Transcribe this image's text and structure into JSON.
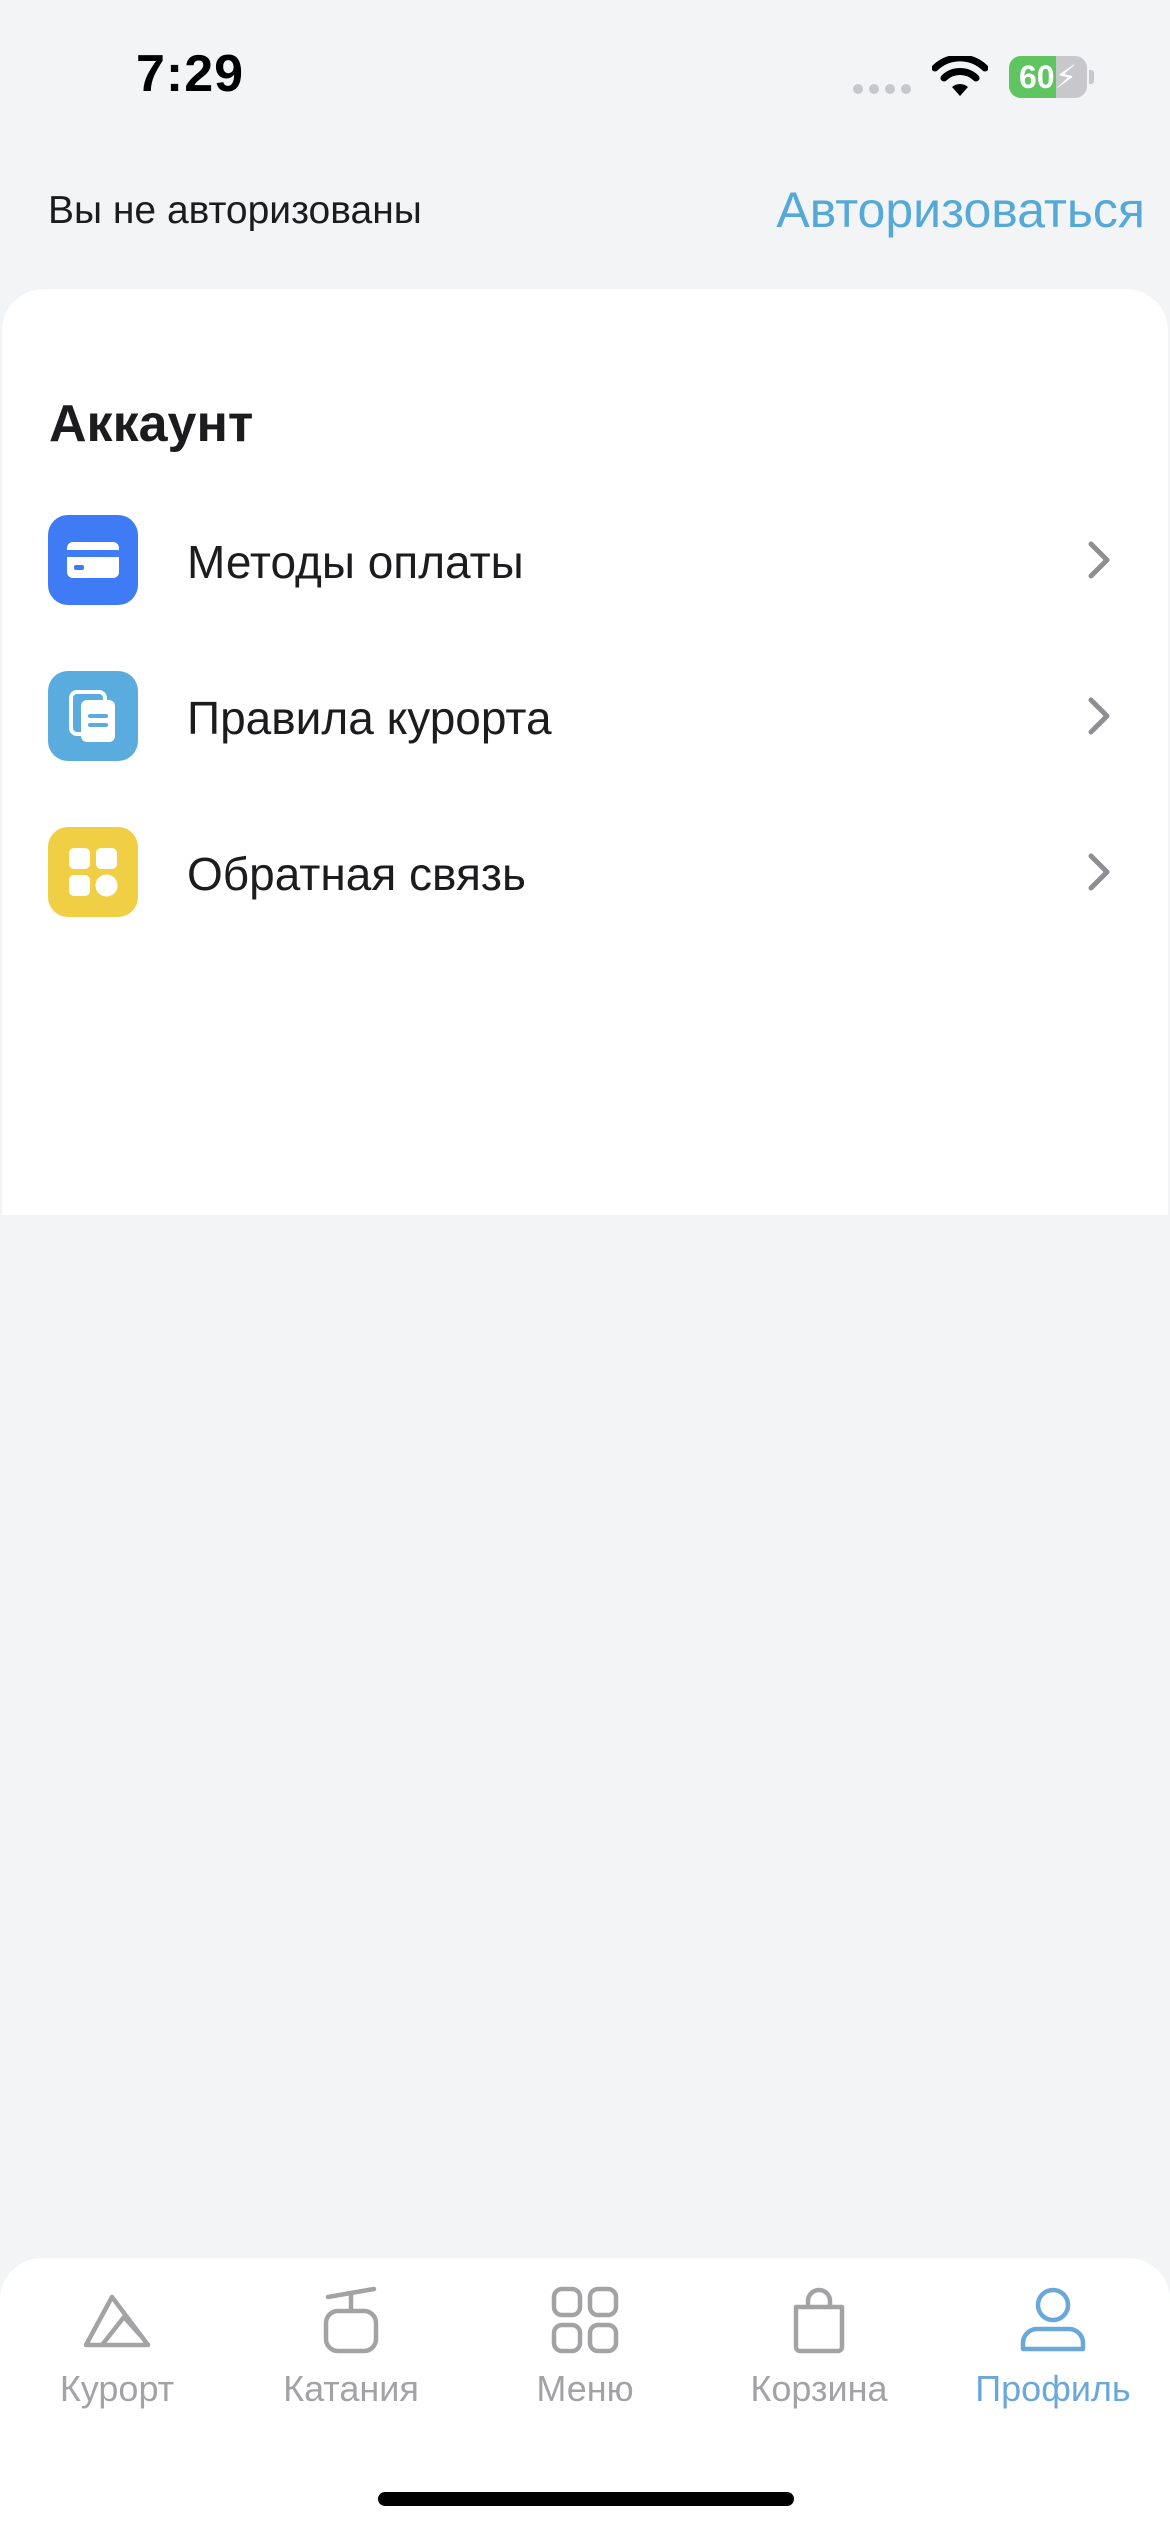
{
  "status_bar": {
    "time": "7:29",
    "battery_level": "60",
    "battery_fraction": 0.6,
    "battery_color": "#5fc561"
  },
  "auth": {
    "status_text": "Вы не авторизованы",
    "login_link": "Авторизоваться",
    "accent_color": "#55a9d6"
  },
  "account": {
    "section_title": "Аккаунт",
    "items": [
      {
        "label": "Методы оплаты",
        "icon": "credit-card-icon",
        "icon_color": "#3f7bf5"
      },
      {
        "label": "Правила курорта",
        "icon": "documents-icon",
        "icon_color": "#5aacde"
      },
      {
        "label": "Обратная связь",
        "icon": "grid-shapes-icon",
        "icon_color": "#f0cf45"
      }
    ]
  },
  "tab_bar": {
    "active_color": "#6aa8d9",
    "inactive_color": "#a3a3a6",
    "tabs": [
      {
        "label": "Курорт",
        "icon": "mountain-icon",
        "active": false
      },
      {
        "label": "Катания",
        "icon": "cable-car-icon",
        "active": false
      },
      {
        "label": "Меню",
        "icon": "grid-icon",
        "active": false
      },
      {
        "label": "Корзина",
        "icon": "shopping-bag-icon",
        "active": false
      },
      {
        "label": "Профиль",
        "icon": "profile-icon",
        "active": true
      }
    ]
  }
}
